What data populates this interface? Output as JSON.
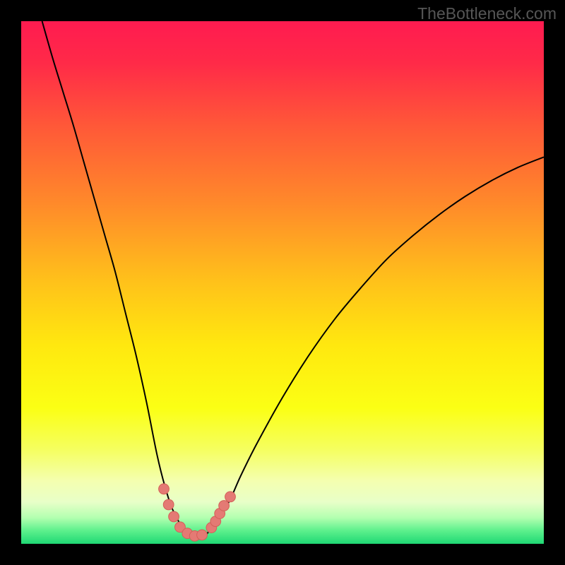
{
  "watermark": {
    "text": "TheBottleneck.com"
  },
  "colors": {
    "frame": "#000000",
    "curve": "#000000",
    "marker_fill": "#e47a74",
    "marker_stroke": "#d45f58",
    "gradient_stops": [
      {
        "offset": 0.0,
        "color": "#ff1b50"
      },
      {
        "offset": 0.08,
        "color": "#ff2a48"
      },
      {
        "offset": 0.2,
        "color": "#ff5838"
      },
      {
        "offset": 0.35,
        "color": "#ff8a2a"
      },
      {
        "offset": 0.5,
        "color": "#ffc21a"
      },
      {
        "offset": 0.62,
        "color": "#ffe80f"
      },
      {
        "offset": 0.74,
        "color": "#fbff14"
      },
      {
        "offset": 0.82,
        "color": "#f5ff60"
      },
      {
        "offset": 0.88,
        "color": "#f4ffb0"
      },
      {
        "offset": 0.92,
        "color": "#e8ffc8"
      },
      {
        "offset": 0.95,
        "color": "#b3ffb0"
      },
      {
        "offset": 0.975,
        "color": "#5cf08c"
      },
      {
        "offset": 1.0,
        "color": "#1fd874"
      }
    ]
  },
  "chart_data": {
    "type": "line",
    "title": "",
    "xlabel": "",
    "ylabel": "",
    "xlim": [
      0,
      100
    ],
    "ylim": [
      0,
      100
    ],
    "grid": false,
    "legend": false,
    "annotations": [],
    "series": [
      {
        "name": "bottleneck-curve",
        "x": [
          4,
          6,
          8,
          10,
          12,
          14,
          16,
          18,
          20,
          22,
          24,
          26,
          27.5,
          29,
          31,
          33,
          35,
          36,
          38,
          40,
          42,
          45,
          50,
          55,
          60,
          65,
          70,
          75,
          80,
          85,
          90,
          95,
          100
        ],
        "y": [
          100,
          93,
          86.5,
          80,
          73,
          66,
          59,
          52,
          44,
          36,
          27,
          17,
          11,
          6.5,
          3,
          1.5,
          1.5,
          2.5,
          5,
          8.5,
          13,
          19,
          28,
          36,
          43,
          49,
          54.5,
          59,
          63,
          66.5,
          69.5,
          72,
          74
        ],
        "style": {
          "stroke_width": 2
        }
      }
    ],
    "markers": {
      "name": "highlighted-range",
      "shape": "circle",
      "radius_pct": 1.0,
      "points": [
        {
          "x": 27.3,
          "y": 10.5
        },
        {
          "x": 28.2,
          "y": 7.5
        },
        {
          "x": 29.2,
          "y": 5.2
        },
        {
          "x": 30.4,
          "y": 3.2
        },
        {
          "x": 31.8,
          "y": 2.0
        },
        {
          "x": 33.2,
          "y": 1.5
        },
        {
          "x": 34.6,
          "y": 1.7
        },
        {
          "x": 36.4,
          "y": 3.1
        },
        {
          "x": 37.2,
          "y": 4.3
        },
        {
          "x": 38.0,
          "y": 5.8
        },
        {
          "x": 38.8,
          "y": 7.3
        },
        {
          "x": 40.0,
          "y": 9.0
        }
      ]
    }
  }
}
